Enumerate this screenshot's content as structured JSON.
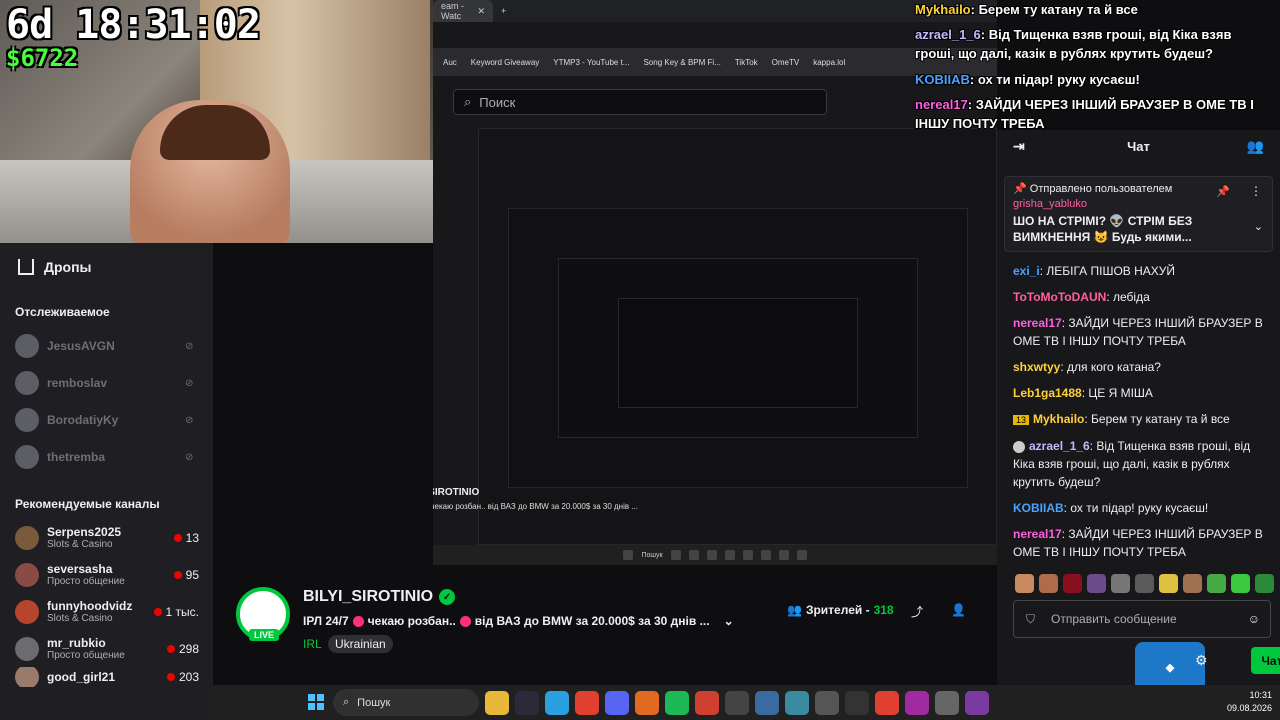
{
  "overlay": {
    "timer": "6d 18:31:02",
    "money": "$6722"
  },
  "overlay_chat": [
    {
      "user": "Mykhailo",
      "text": "Берем ту катану та й все",
      "color": "#ffd23a"
    },
    {
      "user": "azrael_1_6",
      "text": "Від Тищенка взяв гроші, від Кіка взяв",
      "color": "#c9b6ff"
    },
    {
      "user": "",
      "text": "гроші, що далі, казік в рублях крутить будеш?",
      "color": "#ffffff"
    },
    {
      "user": "KOBIIAB",
      "text": "ох ти підар! руку кусаєш!",
      "color": "#4aa3ff"
    },
    {
      "user": "nereal17",
      "text": "ЗАЙДИ ЧЕРЕЗ ІНШИЙ БРАУЗЕР В ОМЕ ТВ І",
      "color": "#ff5fe0"
    },
    {
      "user": "",
      "text": "ІНШУ ПОЧТУ ТРЕБА",
      "color": "#ffffff"
    }
  ],
  "browser": {
    "tab_title": "eam - Watc",
    "bookmarks": [
      "Auc",
      "Keyword Giveaway",
      "YTMP3 - YouTube t...",
      "Song Key & BPM Fi...",
      "TikTok",
      "OmeTV",
      "kappa.lol"
    ],
    "search_placeholder": "Поиск",
    "taskbar_search": "Пошук"
  },
  "sidebar": {
    "drops_label": "Дропы",
    "following_title": "Отслеживаемое",
    "following": [
      {
        "name": "JesusAVGN"
      },
      {
        "name": "remboslav"
      },
      {
        "name": "BorodatiyKy"
      },
      {
        "name": "thetremba"
      }
    ],
    "recommended_title": "Рекомендуемые каналы",
    "recommended": [
      {
        "name": "Serpens2025",
        "category": "Slots & Casino",
        "viewers": "13"
      },
      {
        "name": "seversasha",
        "category": "Просто общение",
        "viewers": "95"
      },
      {
        "name": "funnyhoodvidz",
        "category": "Slots & Casino",
        "viewers": "1 тыс."
      },
      {
        "name": "mr_rubkio",
        "category": "Просто общение",
        "viewers": "298"
      },
      {
        "name": "good_girl21",
        "category": "",
        "viewers": "203"
      }
    ]
  },
  "channel": {
    "name": "BILYI_SIROTINIO",
    "title": "ІРЛ 24/7 чекаю розбан.. від ВАЗ до BMW за 20.000$ за 30 днів ...",
    "title_part1": "ІРЛ 24/7",
    "title_part2": "чекаю розбан..",
    "title_part3": "від ВАЗ до BMW за 20.000$ за 30 днів ...",
    "category": "IRL",
    "tag": "Ukrainian",
    "live_label": "LIVE",
    "viewers_label": "Зрителей -",
    "viewers_count": "318"
  },
  "chat": {
    "header": "Чат",
    "pinned_header": "Отправлено пользователем",
    "pinned_user": "grisha_yabluko",
    "pinned_text": "ШО НА СТРІМІ? 👽 СТРІМ БЕЗ ВИМКНЕННЯ 😺 Будь якими...",
    "messages": [
      {
        "user": "exi_i",
        "text": "ЛЕБІГА ПІШОВ НАХУЙ",
        "color": "#4aa3ff"
      },
      {
        "user": "ToToMoToDAUN",
        "text": "лебіда",
        "color": "#ff5fa2"
      },
      {
        "user": "nereal17",
        "text": "ЗАЙДИ ЧЕРЕЗ ІНШИЙ БРАУЗЕР В ОМЕ ТВ І ІНШУ ПОЧТУ ТРЕБА",
        "color": "#ff5fe0"
      },
      {
        "user": "shxwtyy",
        "text": "для кого катана?",
        "color": "#ffd23a"
      },
      {
        "user": "Leb1ga1488",
        "text": "ЦЕ Я МІША",
        "color": "#ffd23a"
      },
      {
        "user": "Mykhailo",
        "text": "Берем ту катану та й все",
        "color": "#ffd23a"
      },
      {
        "user": "azrael_1_6",
        "text": "Від Тищенка взяв гроші, від Кіка взяв гроші, що далі, казік в рублях крутить будеш?",
        "color": "#c9b6ff"
      },
      {
        "user": "KOBIIAB",
        "text": "ох ти підар! руку кусаєш!",
        "color": "#4aa3ff"
      },
      {
        "user": "nereal17",
        "text": "ЗАЙДИ ЧЕРЕЗ ІНШИЙ БРАУЗЕР В ОМЕ ТВ І ІНШУ ПОЧТУ ТРЕБА",
        "color": "#ff5fe0"
      }
    ],
    "send_placeholder": "Отправить сообщение",
    "chat_button": "Чат"
  },
  "taskbar": {
    "time": "10:31",
    "date": "09.08.2026"
  },
  "colors": {
    "accent_green": "#00c83c",
    "money_green": "#46ff3a"
  }
}
